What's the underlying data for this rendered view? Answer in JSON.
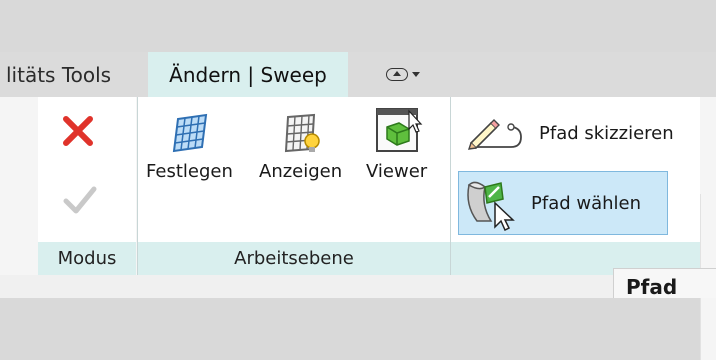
{
  "tabs": {
    "previous_label": "litäts Tools",
    "active_label": "Ändern | Sweep"
  },
  "panels": {
    "modus": {
      "label": "Modus"
    },
    "arbeitsebene": {
      "label": "Arbeitsebene",
      "buttons": {
        "festlegen": "Festlegen",
        "anzeigen": "Anzeigen",
        "viewer": "Viewer"
      }
    },
    "sweep": {
      "pfad_skizzieren": "Pfad skizzieren",
      "pfad_waehlen": "Pfad wählen"
    }
  },
  "properties_panel": {
    "title_fragment": "Pfad"
  },
  "colors": {
    "active_tab": "#d9efee",
    "highlight": "#cce8f8",
    "highlight_border": "#7fb8de",
    "cancel_red": "#e0332b"
  }
}
